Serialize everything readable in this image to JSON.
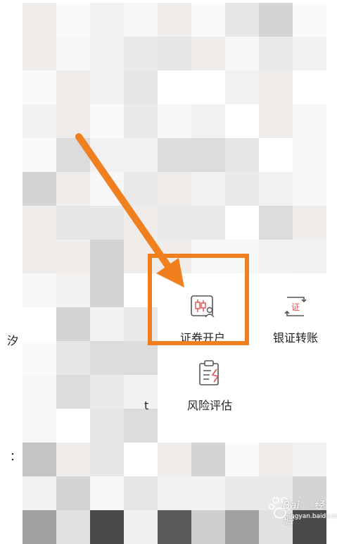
{
  "menu": {
    "items": [
      {
        "id": "securities-open-account",
        "label": "证券开户",
        "icon": "candlestick-user-icon"
      },
      {
        "id": "bank-securities-transfer",
        "label": "银证转账",
        "icon": "transfer-cert-icon",
        "badge": "证"
      },
      {
        "id": "risk-assessment",
        "label": "风险评估",
        "icon": "clipboard-check-icon"
      }
    ]
  },
  "edge_fragments": {
    "left_row1": "汐",
    "left_row3": "：",
    "mid_row2": "t"
  },
  "highlight": {
    "color": "#f07f1f",
    "target": "证券开户"
  },
  "watermark": {
    "brand": "Bai",
    "brand2": "经验",
    "sub": "jingyan.baidu.com"
  },
  "colors": {
    "accent": "#f07f1f",
    "icon_red": "#d9534f",
    "icon_gray": "#555555"
  }
}
